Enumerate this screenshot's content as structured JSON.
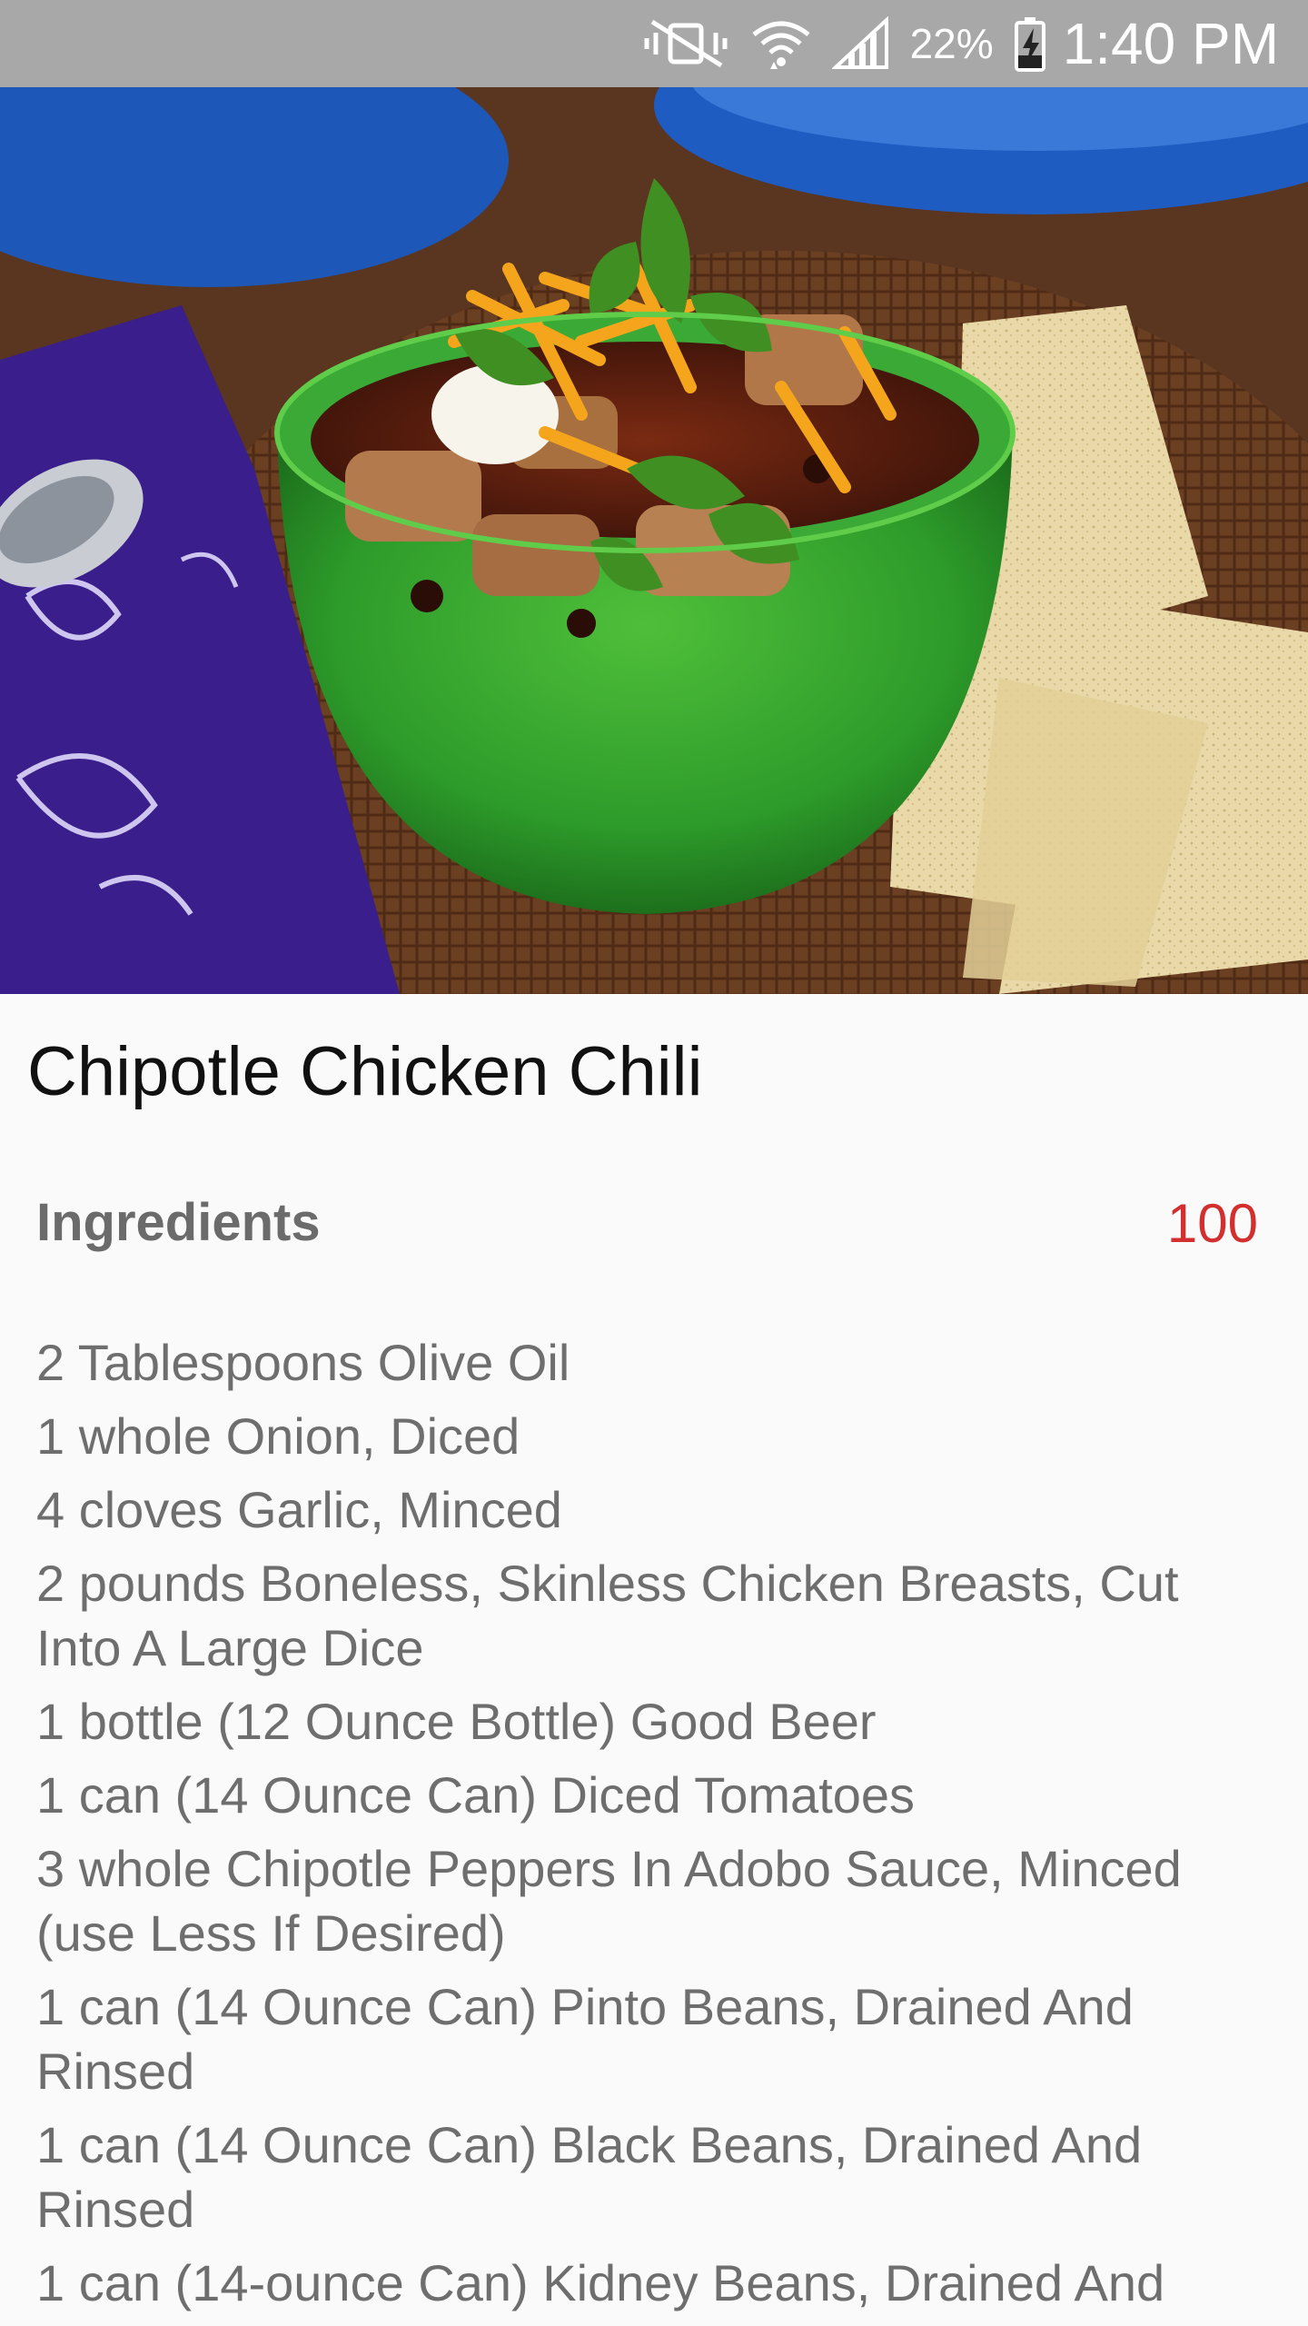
{
  "status_bar": {
    "battery_percent": "22%",
    "time": "1:40 PM",
    "icons": [
      "mute-vibrate-icon",
      "wifi-icon",
      "signal-icon",
      "battery-charging-icon"
    ]
  },
  "hero": {
    "image": "chipotle-chicken-chili-photo"
  },
  "recipe": {
    "title": "Chipotle Chicken Chili",
    "ingredients_label": "Ingredients",
    "ingredients_count": "100",
    "ingredients": [
      "2 Tablespoons Olive Oil",
      "1 whole Onion, Diced",
      "4 cloves Garlic, Minced",
      "2 pounds Boneless, Skinless Chicken Breasts, Cut Into A Large Dice",
      "1 bottle (12 Ounce Bottle) Good Beer",
      "1 can (14 Ounce Can) Diced Tomatoes",
      "3 whole Chipotle Peppers In Adobo Sauce, Minced (use Less If Desired)",
      "1 can (14 Ounce Can) Pinto Beans, Drained And Rinsed",
      "1 can (14 Ounce Can) Black Beans, Drained And Rinsed",
      "1 can (14-ounce Can) Kidney Beans, Drained And"
    ]
  },
  "colors": {
    "status_bar_bg": "#a8a8a8",
    "accent_count": "#d32f2f",
    "title_text": "#111111",
    "ingredient_text": "#6e6e6e"
  }
}
